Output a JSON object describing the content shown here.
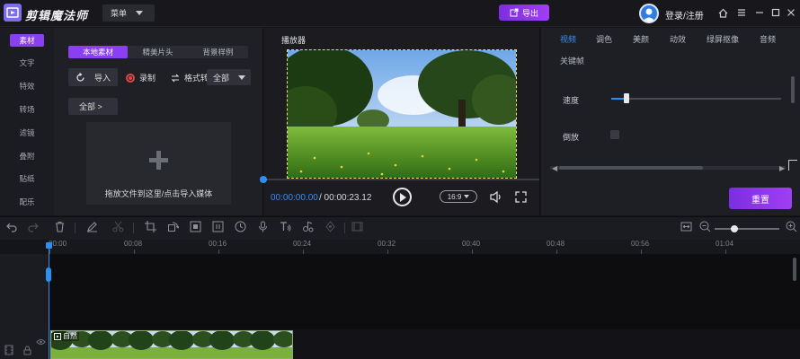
{
  "app": {
    "title": "剪辑魔法师",
    "menu_label": "菜单",
    "export_label": "导出",
    "login_label": "登录/注册"
  },
  "left_nav": {
    "items": [
      "素材",
      "文字",
      "特效",
      "转场",
      "滤镜",
      "叠附",
      "贴纸",
      "配乐"
    ]
  },
  "media": {
    "tabs": [
      "本地素材",
      "精美片头",
      "背景样例"
    ],
    "import_label": "导入",
    "record_label": "录制",
    "format_label": "格式转",
    "filter_value": "全部",
    "crumb_label": "全部 >",
    "drop_hint": "拖放文件到这里/点击导入媒体"
  },
  "player": {
    "title": "播放器",
    "current_time": "00:00:00.00",
    "total_time": "/ 00:00:23.12",
    "aspect_ratio": "16:9",
    "progress": 0
  },
  "props": {
    "tabs": [
      "视频",
      "调色",
      "美颜",
      "动效",
      "绿屏抠像",
      "音频"
    ],
    "tab_row2": [
      "关键帧"
    ],
    "speed_label": "速度",
    "reverse_label": "倒放",
    "reset_label": "重置",
    "accent": "#3a8df0"
  },
  "timeline": {
    "ticks": [
      "00:00",
      "00:08",
      "00:16",
      "00:24",
      "00:32",
      "00:40",
      "00:48",
      "00:56",
      "01:04"
    ],
    "clip_label": "自然"
  },
  "colors": {
    "brand_purple": "#8a3ff0",
    "playhead_blue": "#2d8ff0"
  }
}
